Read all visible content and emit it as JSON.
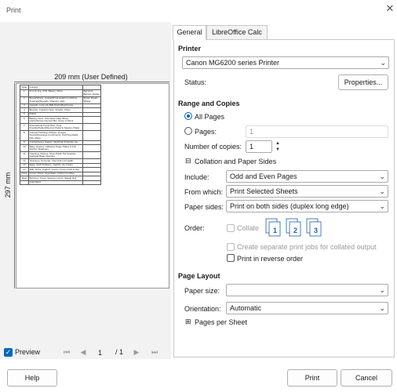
{
  "window": {
    "title": "Print",
    "close_glyph": "✕"
  },
  "preview": {
    "width_label": "209 mm (User Defined)",
    "height_label": "297 mm",
    "preview_label": "Preview",
    "page_current": "1",
    "page_total": "/ 1",
    "doc_rows": [
      [
        "Aisle",
        "Content",
        ""
      ],
      [
        "1",
        "Fruit & Veg, Chill, Bakery, Menu",
        "Bananas, Berries, Apples"
      ],
      [
        "2",
        "Bread/Wraps, Custard/Fruit Health Food/Nuts, Toppings/Spreads, Vitamins, Jelly",
        "Brown Bread, Wraps"
      ],
      [
        "3",
        "Cereals, Long Life Milk Tea/Coffee/Cocoa",
        ""
      ],
      [
        "4",
        "Biscuits, Crackers Nuts, Snacks, Chips",
        ""
      ],
      [
        "5",
        "Drinks",
        ""
      ],
      [
        "6",
        "Baking, Flour, Chocolate Cake Mixes, Herbs/Spices Canned Mix, Gravy & Stock",
        ""
      ],
      [
        "7",
        "International Foods Rice, Tong Noodles/Italian/Mexican Pasta & Sauces, Pasta",
        ""
      ],
      [
        "8",
        "Canned Fish/Veg, Pickles, Vinegar, Soups/Dressings Condiments, Fish/Veg Meals, Oils, Mayo",
        ""
      ],
      [
        "9",
        "Confectionery Sugars, Medicinal Products, Ice",
        ""
      ],
      [
        "10",
        "Baby, Hosiery, Giftwares Paper Plates & Foil Kitchen Stationery",
        ""
      ],
      [
        "11",
        "Cleaning, Tissues, Shoe Polish Pet Supplies, Garbage Bags Cleaning",
        ""
      ],
      [
        "12",
        "Shampoo, Personal, Chemical List Health",
        ""
      ],
      [
        "13",
        "Eggs, Stuff Chickens, Yoghurt, Ice Cream",
        ""
      ],
      [
        "14",
        "Milk, Pizza, Yoghurt, Cream, Frozen Fish & Veg",
        ""
      ],
      [
        "Fresh",
        "Frozen Pizza, Vegetables, Kitchen Foodles",
        ""
      ],
      [
        "Rest",
        "Butchery, Fresh, Savoury Lunch, Salads Deli",
        ""
      ],
      [
        "",
        "Liquorland",
        ""
      ]
    ]
  },
  "tabs": [
    {
      "label": "General",
      "selected": true
    },
    {
      "label": "LibreOffice Calc",
      "selected": false
    }
  ],
  "printer": {
    "section": "Printer",
    "selected_printer": "Canon MG6200 series Printer",
    "status_label": "Status:",
    "properties_button": "Properties..."
  },
  "range": {
    "section": "Range and Copies",
    "all_pages": "All Pages",
    "pages_label": "Pages:",
    "pages_value": "1",
    "copies_label": "Number of copies:",
    "copies_value": "1"
  },
  "collation": {
    "expander": "Collation and Paper Sides",
    "include_label": "Include:",
    "include_value": "Odd and Even Pages",
    "from_label": "From which:",
    "from_value": "Print Selected Sheets",
    "sides_label": "Paper sides:",
    "sides_value": "Print on both sides (duplex long edge)",
    "order_label": "Order:",
    "collate_label": "Collate",
    "separate_jobs": "Create separate print jobs for collated output",
    "reverse_order": "Print in reverse order"
  },
  "layout": {
    "section": "Page Layout",
    "paper_size_label": "Paper size:",
    "paper_size_value": "",
    "orientation_label": "Orientation:",
    "orientation_value": "Automatic",
    "pages_per_sheet": "Pages per Sheet"
  },
  "buttons": {
    "help": "Help",
    "print": "Print",
    "cancel": "Cancel"
  },
  "colors": {
    "accent": "#0067c0",
    "pane": "#f2f2f2"
  }
}
